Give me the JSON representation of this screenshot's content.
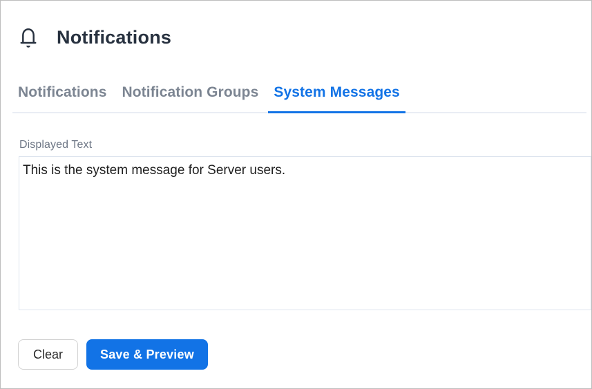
{
  "header": {
    "title": "Notifications",
    "icon": "bell-icon"
  },
  "tabs": [
    {
      "label": "Notifications",
      "active": false
    },
    {
      "label": "Notification Groups",
      "active": false
    },
    {
      "label": "System Messages",
      "active": true
    }
  ],
  "form": {
    "label": "Displayed Text",
    "textarea_value": "This is the system message for Server users."
  },
  "buttons": {
    "clear": "Clear",
    "save_preview": "Save & Preview"
  },
  "colors": {
    "accent_blue": "#1273e6",
    "title_navy": "#27313f",
    "tab_inactive_gray": "#7c8592",
    "divider": "#e9edf4",
    "textarea_border": "#dde4ee"
  }
}
